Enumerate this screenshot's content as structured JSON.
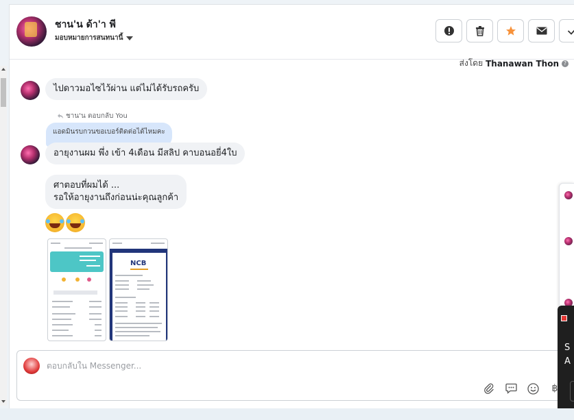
{
  "header": {
    "contact_name": "ชาน'น ด้า'า พี",
    "assign_label": "มอบหมายการสนทนานี้",
    "actions": [
      {
        "name": "report-button",
        "icon": "exclamation-icon"
      },
      {
        "name": "delete-button",
        "icon": "trash-icon"
      },
      {
        "name": "star-button",
        "icon": "star-icon"
      },
      {
        "name": "mail-button",
        "icon": "envelope-icon"
      },
      {
        "name": "done-button",
        "icon": "check-icon"
      }
    ]
  },
  "conversation": {
    "sent_by_prefix": "ส่งโดย",
    "sent_by_name": "Thanawan Thon",
    "messages": [
      {
        "text": "ไปดาวมอไซไว้ผ่าน แต่ไม่ได้รับรถครับ"
      },
      {
        "text": "อายุงานผม พึ่ง เข้า 4เดือน มีสลิป คาบอนอยี่4ใบ"
      },
      {
        "text_line1": "ศาตอบที่ผมได้ ...",
        "text_line2": "รอให้อายุงานถึงก่อนน่ะคุณลูกค้า"
      }
    ],
    "reply_label": "ชาน'น ตอบกลับ You",
    "quoted_text": "แอดมินรบกวนขอเบอร์ติดต่อได้ไหมคะ",
    "emoji": "rolling-on-floor-laughing-emoji",
    "attachment_2_logo": "NCB"
  },
  "composer": {
    "placeholder": "ตอบกลับใน Messenger..."
  },
  "overlay": {
    "dark_line1": "S",
    "dark_line2": "A"
  },
  "colors": {
    "star": "#f7923a",
    "quoted_bubble": "#d7e6fb",
    "bubble": "#f0f2f5"
  }
}
